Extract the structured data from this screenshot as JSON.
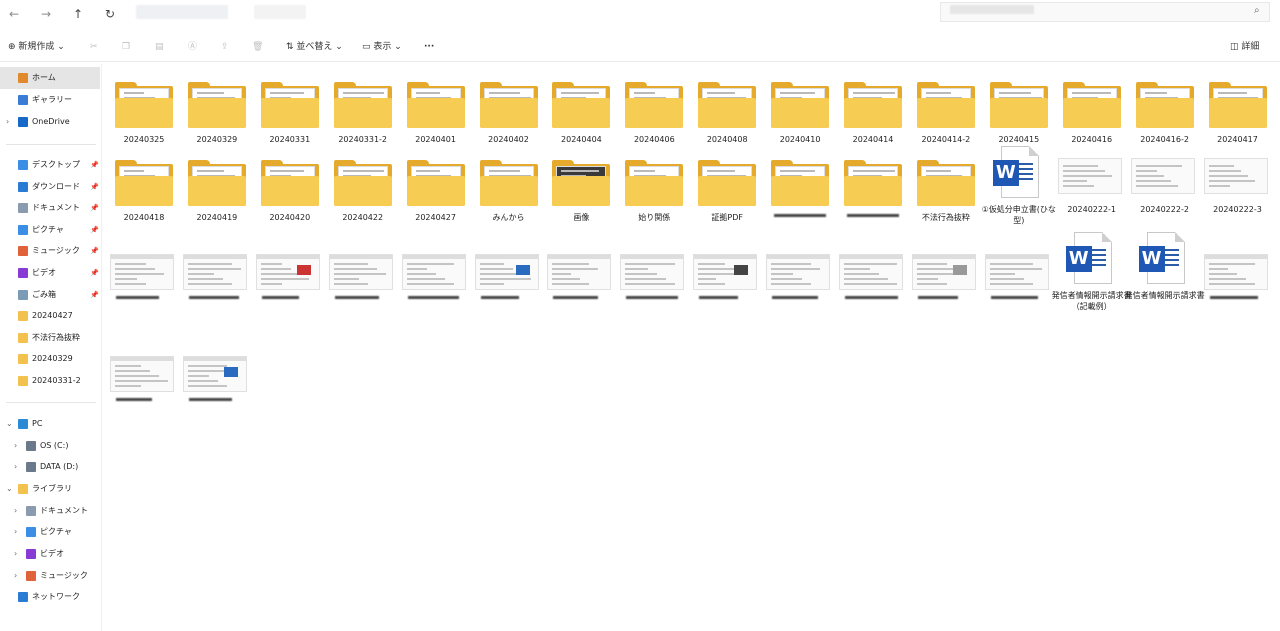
{
  "window": {
    "nav": {
      "back": "←",
      "forward": "→",
      "up": "↑",
      "refresh": "↻"
    },
    "search_icon": "search-icon"
  },
  "toolbar": {
    "new_label": "新規作成",
    "sort_label": "並べ替え",
    "view_label": "表示",
    "more_label": "···",
    "details_label": "詳細"
  },
  "sidebar": {
    "top": [
      {
        "label": "ホーム",
        "icon": "home-icon",
        "selected": true
      },
      {
        "label": "ギャラリー",
        "icon": "gallery-icon"
      },
      {
        "label": "OneDrive",
        "icon": "cloud-icon",
        "expandable": true
      }
    ],
    "quick_access": [
      {
        "label": "デスクトップ",
        "icon": "desktop-icon"
      },
      {
        "label": "ダウンロード",
        "icon": "download-icon"
      },
      {
        "label": "ドキュメント",
        "icon": "documents-icon"
      },
      {
        "label": "ピクチャ",
        "icon": "pictures-icon"
      },
      {
        "label": "ミュージック",
        "icon": "music-icon"
      },
      {
        "label": "ビデオ",
        "icon": "video-icon"
      },
      {
        "label": "ごみ箱",
        "icon": "trash-icon"
      },
      {
        "label": "20240427",
        "icon": "folder-icon"
      },
      {
        "label": "不法行為抜粋",
        "icon": "folder-icon"
      },
      {
        "label": "20240329",
        "icon": "folder-icon"
      },
      {
        "label": "20240331-2",
        "icon": "folder-icon"
      }
    ],
    "tree": [
      {
        "label": "PC",
        "icon": "pc-icon",
        "expanded": true,
        "indent": 0
      },
      {
        "label": "OS (C:)",
        "icon": "drive-icon",
        "indent": 1
      },
      {
        "label": "DATA (D:)",
        "icon": "drive-icon",
        "indent": 1
      },
      {
        "label": "ライブラリ",
        "icon": "library-icon",
        "expanded": true,
        "indent": 0
      },
      {
        "label": "ドキュメント",
        "icon": "documents-icon",
        "indent": 1
      },
      {
        "label": "ピクチャ",
        "icon": "pictures-icon",
        "indent": 1
      },
      {
        "label": "ビデオ",
        "icon": "video-icon",
        "indent": 1
      },
      {
        "label": "ミュージック",
        "icon": "music-icon",
        "indent": 1
      },
      {
        "label": "ネットワーク",
        "icon": "network-icon",
        "indent": 0
      }
    ]
  },
  "files": {
    "row1": [
      "20240325",
      "20240329",
      "20240331",
      "20240331-2",
      "20240401",
      "20240402",
      "20240404",
      "20240406",
      "20240408",
      "20240410",
      "20240414",
      "20240414-2",
      "20240415",
      "20240416",
      "20240416-2",
      "20240417"
    ],
    "row2": [
      "20240418",
      "20240419",
      "20240420",
      "20240422",
      "20240427",
      "みんから",
      "画像",
      "始り関係",
      "証拠PDF",
      "",
      "",
      "不法行為抜粋",
      "①仮処分申立書(ひな型)",
      "20240222-1",
      "20240222-2",
      "20240222-3"
    ],
    "row3_docs": [
      "発信者情報開示請求書（記載例）",
      "発信者情報開示請求書"
    ]
  },
  "colors": {
    "folder": "#f7cc52",
    "folder_back": "#e5a92b",
    "word": "#1f57b4",
    "selection": "#e5e5e5"
  }
}
